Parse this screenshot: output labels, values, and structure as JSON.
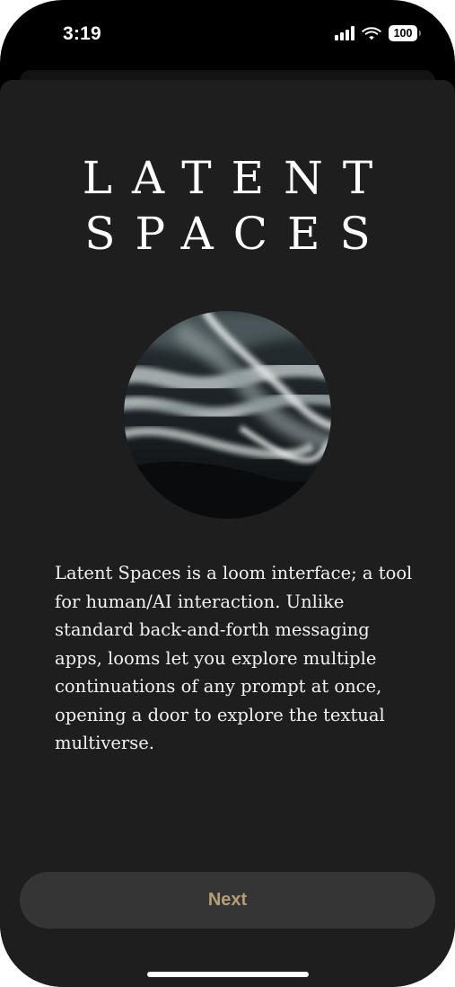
{
  "status_bar": {
    "time": "3:19",
    "battery_level": "100",
    "signal_icon": "cellular-signal-icon",
    "wifi_icon": "wifi-icon",
    "battery_icon": "battery-icon"
  },
  "onboarding": {
    "title_line_1": "LATENT",
    "title_line_2": "SPACES",
    "hero_image": "abstract-flowing-silk-image",
    "description": "Latent Spaces is a loom interface; a tool for human/AI interaction. Unlike standard back-and-forth messaging apps, looms let you explore multiple continuations of any prompt at once, opening a door to explore the textual multiverse.",
    "next_label": "Next"
  },
  "colors": {
    "background": "#000000",
    "sheet": "#1e1e1f",
    "button": "#353536",
    "button_text": "#b59f77",
    "text": "#ffffff"
  }
}
